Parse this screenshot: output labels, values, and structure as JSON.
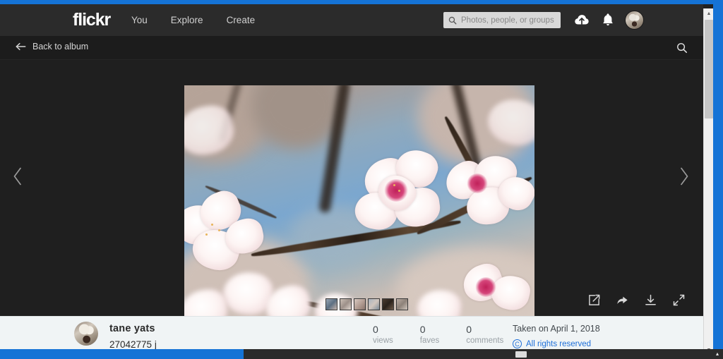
{
  "global_nav": {
    "logo": "flickr",
    "links": [
      {
        "label": "You",
        "name": "nav-link-you"
      },
      {
        "label": "Explore",
        "name": "nav-link-explore"
      },
      {
        "label": "Create",
        "name": "nav-link-create"
      }
    ],
    "search": {
      "placeholder": "Photos, people, or groups",
      "value": ""
    },
    "icons": {
      "upload": "cloud-upload-icon",
      "notifications": "bell-icon",
      "avatar": "user-avatar"
    },
    "background_color": "#2b2b2b"
  },
  "sub_nav": {
    "back_label": "Back to album",
    "back_icon": "arrow-left-icon",
    "search_icon": "search-icon",
    "background_color": "#1c1c1c"
  },
  "photo_view": {
    "alt": "Cherry blossom branches against blue sky",
    "prev_icon": "chevron-left-icon",
    "next_icon": "chevron-right-icon",
    "background_color": "#1f1f1f",
    "thumbnails": [
      {
        "name": "thumbnail-1"
      },
      {
        "name": "thumbnail-2"
      },
      {
        "name": "thumbnail-3"
      },
      {
        "name": "thumbnail-4"
      },
      {
        "name": "thumbnail-5"
      },
      {
        "name": "thumbnail-6"
      }
    ],
    "actions": [
      {
        "name": "edit-photo-button",
        "icon": "pencil-square-icon"
      },
      {
        "name": "share-photo-button",
        "icon": "share-arrow-icon"
      },
      {
        "name": "download-photo-button",
        "icon": "download-icon"
      },
      {
        "name": "fullscreen-button",
        "icon": "expand-icon"
      }
    ]
  },
  "info_bar": {
    "owner_name": "tane yats",
    "photo_title": "27042775 j",
    "stats": [
      {
        "value": "0",
        "label": "views",
        "name": "stat-views"
      },
      {
        "value": "0",
        "label": "faves",
        "name": "stat-faves"
      },
      {
        "value": "0",
        "label": "comments",
        "name": "stat-comments"
      }
    ],
    "taken_on": "Taken on April 1, 2018",
    "rights_text": "All rights reserved",
    "rights_icon_glyph": "C",
    "link_color": "#1e6fd9",
    "background_color": "#f0f4f5"
  },
  "window_chrome": {
    "accent_color": "#1573d6",
    "scrollbar": {
      "up_glyph": "▲",
      "down_glyph": "▼"
    },
    "taskbar_caret": "▴"
  }
}
